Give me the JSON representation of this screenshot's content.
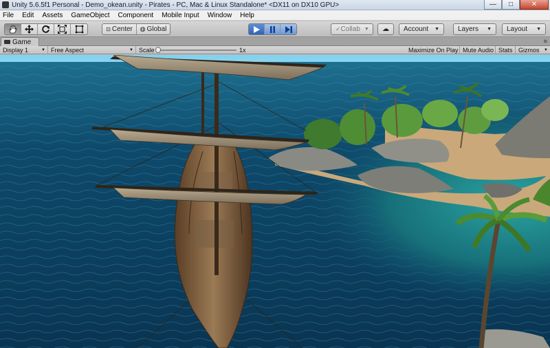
{
  "window": {
    "title": "Unity 5.6.5f1 Personal - Demo_okean.unity - Pirates - PC, Mac & Linux Standalone* <DX11 on DX10 GPU>",
    "minimize": "—",
    "maximize": "□",
    "close": "✕"
  },
  "menu": [
    "File",
    "Edit",
    "Assets",
    "GameObject",
    "Component",
    "Mobile Input",
    "Window",
    "Help"
  ],
  "toolbar": {
    "tools": [
      "hand-icon",
      "move-icon",
      "rotate-icon",
      "scale-icon",
      "rect-tool-icon"
    ],
    "pivot": "Center",
    "space": "Global",
    "play": "play-icon",
    "pause": "pause-icon",
    "step": "step-icon",
    "collab": "Collab",
    "account": "Account",
    "layers": "Layers",
    "layout": "Layout"
  },
  "tab": {
    "name": "Game"
  },
  "game_bar": {
    "display": "Display 1",
    "aspect": "Free Aspect",
    "scale_label": "Scale",
    "scale_value": "1x",
    "maximize_on_play": "Maximize On Play",
    "mute_audio": "Mute Audio",
    "stats": "Stats",
    "gizmos": "Gizmos"
  },
  "colors": {
    "play_blue": "#2f63b4",
    "sea_deep": "#0b3a5e",
    "sea_shallow": "#1f8f8f",
    "sky": "#8fd3ee",
    "sand": "#c8a878"
  }
}
